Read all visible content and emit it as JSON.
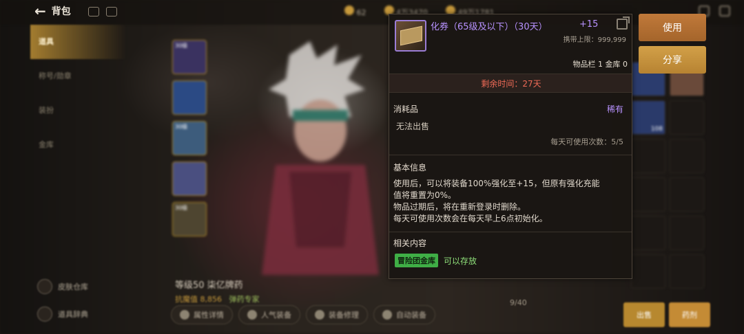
{
  "header": {
    "back_label": "背包",
    "currencies": [
      "62",
      "4万3470",
      "49万1781"
    ]
  },
  "sidebar": {
    "items": [
      {
        "label": "道具",
        "active": true
      },
      {
        "label": "称号/勋章",
        "active": false
      },
      {
        "label": "装扮",
        "active": false
      },
      {
        "label": "金库",
        "active": false
      }
    ],
    "bottom_links": [
      "皮肤仓库",
      "道具辞典"
    ]
  },
  "equipment_slots": [
    {
      "label": "30级"
    },
    {
      "label": ""
    },
    {
      "label": "30级"
    },
    {
      "label": ""
    },
    {
      "label": "30级"
    }
  ],
  "character": {
    "name": "等级50 柒亿牌药",
    "power_label": "抗魔值",
    "power_value": "8,856",
    "title": "弹药专家"
  },
  "tabs": [
    "属性详情",
    "人气装备",
    "装备修理",
    "自动装备"
  ],
  "inventory": {
    "count": "9/40",
    "badge_108": "108",
    "sell_label": "出售",
    "craft_label": "药剂"
  },
  "tooltip": {
    "title": "化券（65级及以下）（30天）",
    "plus": "+15",
    "capacity": "携带上限：999,999",
    "slot_info": "物品栏 1 金库 0",
    "remaining": "剩余时间：27天",
    "category": "消耗品",
    "rarity": "稀有",
    "trade": "无法出售",
    "daily_uses": "每天可使用次数：5/5",
    "basic_info_head": "基本信息",
    "description": [
      "使用后，可以将装备100%强化至+15，但原有强化充能",
      "值将重置为0%。",
      "物品过期后，将在重新登录时删除。",
      "每天可使用次数会在每天早上6点初始化。"
    ],
    "related_head": "相关内容",
    "related_tag": "冒险团金库",
    "related_note": "可以存放"
  },
  "actions": {
    "use_label": "使用",
    "share_label": "分享"
  },
  "colors": {
    "rare_purple": "#b892ff",
    "remaining_red": "#f06b57",
    "tag_green": "#3fae46",
    "button_orange": "#b7882f"
  }
}
